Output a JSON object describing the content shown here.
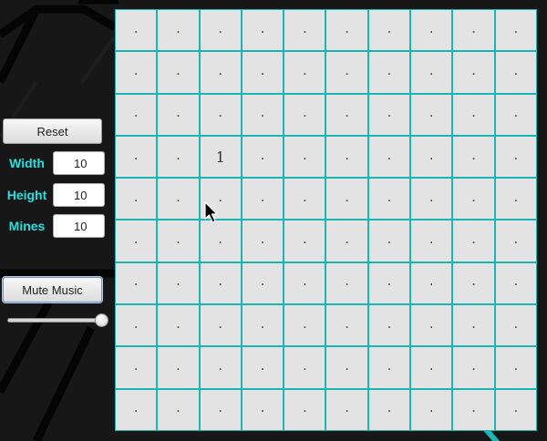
{
  "controls": {
    "reset_label": "Reset",
    "width_label": "Width",
    "width_value": "10",
    "height_label": "Height",
    "height_value": "10",
    "mines_label": "Mines",
    "mines_value": "10",
    "mute_label": "Mute Music",
    "volume_level": 1.0
  },
  "board": {
    "columns": 10,
    "rows": 10,
    "hidden_symbol": ".",
    "revealed_cells": [
      {
        "row": 3,
        "col": 2,
        "value": "1"
      }
    ]
  },
  "colors": {
    "label_accent": "#22e1e1",
    "grid_line": "#1cb4b4",
    "cell_background": "#e3e3e3",
    "page_background": "#161616"
  },
  "cursor_icon": "arrow-cursor-icon"
}
